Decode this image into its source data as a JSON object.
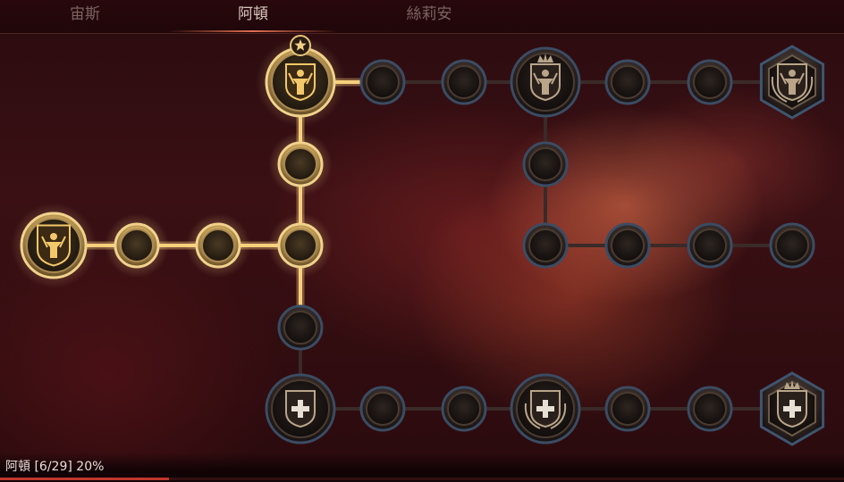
{
  "tabs": [
    {
      "label": "宙斯",
      "active": false
    },
    {
      "label": "阿頓",
      "active": true
    },
    {
      "label": "絲莉安",
      "active": false
    }
  ],
  "footer": {
    "name": "阿頓",
    "count": "[6/29]",
    "percent": "20%",
    "progress": 0.2
  },
  "colors": {
    "gold": "#f3c86a",
    "active_link": "#f6cf7c",
    "inactive_link": "#3a2a28",
    "accent": "#e0704e",
    "progress": "#c2362b"
  },
  "skill_tree": {
    "nodes": [
      {
        "id": "root",
        "kind": "portrait",
        "icon": "warrior-figure-icon",
        "active": true
      },
      {
        "id": "l1",
        "kind": "moon",
        "icon": "moon-icon",
        "active": true
      },
      {
        "id": "l2",
        "kind": "moon",
        "icon": "moon-icon",
        "active": true
      },
      {
        "id": "hub",
        "kind": "moon",
        "icon": "moon-icon",
        "active": true
      },
      {
        "id": "up1",
        "kind": "moon",
        "icon": "moon-icon",
        "active": true
      },
      {
        "id": "top-crest",
        "kind": "crest",
        "icon": "winged-shield-icon",
        "active": true,
        "badge": "star-icon"
      },
      {
        "id": "t1",
        "kind": "moon",
        "icon": "moon-icon",
        "active": false
      },
      {
        "id": "t2",
        "kind": "moon",
        "icon": "moon-icon",
        "active": false
      },
      {
        "id": "t-crest",
        "kind": "crest",
        "icon": "crowned-warrior-icon",
        "active": false
      },
      {
        "id": "t3",
        "kind": "moon",
        "icon": "moon-icon",
        "active": false
      },
      {
        "id": "t4",
        "kind": "moon",
        "icon": "moon-icon",
        "active": false
      },
      {
        "id": "t-end",
        "kind": "hex",
        "icon": "laurel-warrior-icon",
        "active": false
      },
      {
        "id": "m-up",
        "kind": "moon",
        "icon": "moon-icon",
        "active": false
      },
      {
        "id": "m1",
        "kind": "moon",
        "icon": "moon-icon",
        "active": false
      },
      {
        "id": "m2",
        "kind": "moon",
        "icon": "moon-icon",
        "active": false
      },
      {
        "id": "m3",
        "kind": "moon",
        "icon": "moon-icon",
        "active": false
      },
      {
        "id": "m4",
        "kind": "moon",
        "icon": "moon-icon",
        "active": false
      },
      {
        "id": "down1",
        "kind": "moon",
        "icon": "moon-icon",
        "active": false
      },
      {
        "id": "b-crest",
        "kind": "crest",
        "icon": "cross-shield-icon",
        "active": false
      },
      {
        "id": "b1",
        "kind": "moon",
        "icon": "moon-icon",
        "active": false
      },
      {
        "id": "b2",
        "kind": "moon",
        "icon": "moon-icon",
        "active": false
      },
      {
        "id": "b-crest2",
        "kind": "crest",
        "icon": "cross-laurel-icon",
        "active": false
      },
      {
        "id": "b3",
        "kind": "moon",
        "icon": "moon-icon",
        "active": false
      },
      {
        "id": "b4",
        "kind": "moon",
        "icon": "moon-icon",
        "active": false
      },
      {
        "id": "b-end",
        "kind": "hex",
        "icon": "crowned-cross-icon",
        "active": false
      }
    ],
    "links": [
      [
        "root",
        "l1",
        true
      ],
      [
        "l1",
        "l2",
        true
      ],
      [
        "l2",
        "hub",
        true
      ],
      [
        "hub",
        "up1",
        true
      ],
      [
        "up1",
        "top-crest",
        true
      ],
      [
        "top-crest",
        "t1",
        true
      ],
      [
        "t1",
        "t2",
        false
      ],
      [
        "t2",
        "t-crest",
        false
      ],
      [
        "t-crest",
        "t3",
        false
      ],
      [
        "t3",
        "t4",
        false
      ],
      [
        "t4",
        "t-end",
        false
      ],
      [
        "t-crest",
        "m-up",
        false
      ],
      [
        "m-up",
        "m1",
        false
      ],
      [
        "m1",
        "m2",
        false
      ],
      [
        "m2",
        "m3",
        false
      ],
      [
        "m3",
        "m4",
        false
      ],
      [
        "hub",
        "down1",
        true
      ],
      [
        "down1",
        "b-crest",
        false
      ],
      [
        "b-crest",
        "b1",
        false
      ],
      [
        "b1",
        "b2",
        false
      ],
      [
        "b2",
        "b-crest2",
        false
      ],
      [
        "b-crest2",
        "b3",
        false
      ],
      [
        "b3",
        "b4",
        false
      ],
      [
        "b4",
        "b-end",
        false
      ]
    ]
  }
}
